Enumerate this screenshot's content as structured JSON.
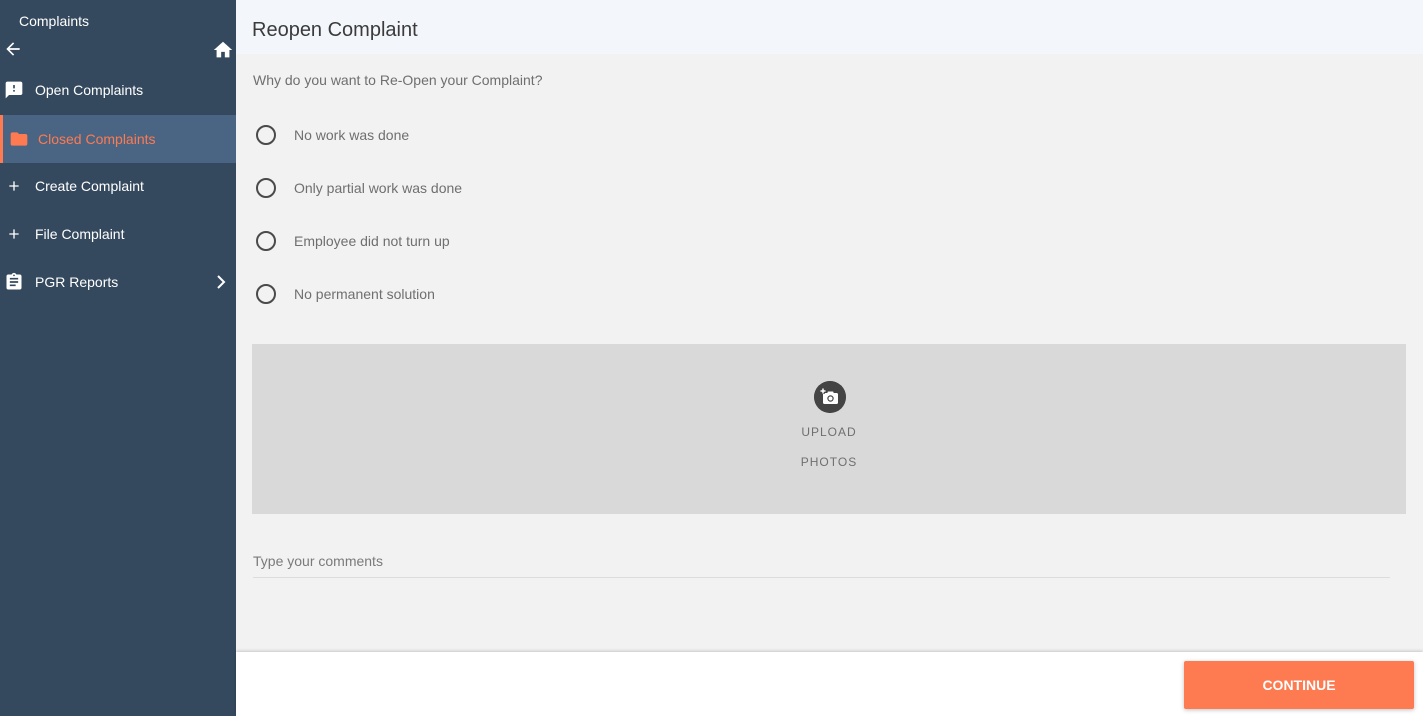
{
  "sidebar": {
    "title": "Complaints",
    "items": [
      {
        "label": "Open Complaints",
        "icon": "feedback-icon",
        "active": false
      },
      {
        "label": "Closed Complaints",
        "icon": "folder-icon",
        "active": true
      },
      {
        "label": "Create Complaint",
        "icon": "plus-icon",
        "active": false
      },
      {
        "label": "File Complaint",
        "icon": "plus-icon",
        "active": false
      },
      {
        "label": "PGR Reports",
        "icon": "clipboard-icon",
        "active": false
      }
    ]
  },
  "main": {
    "title": "Reopen Complaint",
    "question": "Why do you want to Re-Open your Complaint?",
    "options": [
      "No work was done",
      "Only partial work was done",
      "Employee did not turn up",
      "No permanent solution"
    ],
    "upload": {
      "line1": "UPLOAD",
      "line2": "PHOTOS",
      "icon": "add-photo-icon"
    },
    "comments_placeholder": "Type your comments"
  },
  "footer": {
    "continue_label": "CONTINUE"
  },
  "colors": {
    "sidebar_bg": "#35495e",
    "active_bg": "#4a6583",
    "accent": "#fe7a51"
  }
}
